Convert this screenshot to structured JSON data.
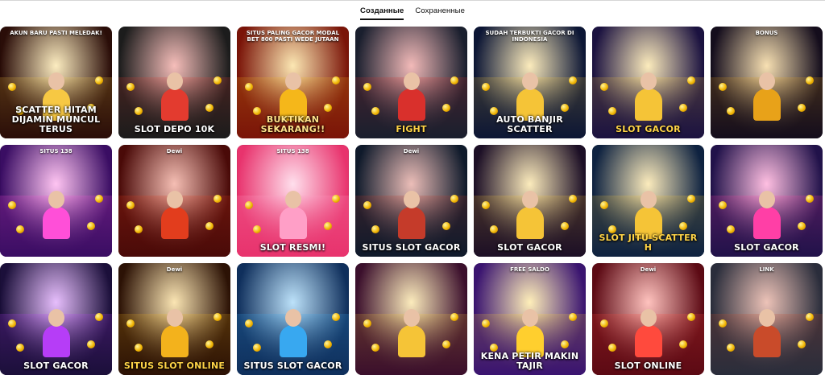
{
  "tabs": [
    {
      "label": "Созданные",
      "active": true
    },
    {
      "label": "Сохраненные",
      "active": false
    }
  ],
  "pins": [
    {
      "top": "AKUN BARU PASTI MELEDAK!",
      "caption": "SCATTER HITAM DIJAMIN MUNCUL TERUS",
      "bg": "#2a0d08",
      "accent": "#f7c843",
      "capColor": "#ffffff"
    },
    {
      "top": "",
      "caption": "SLOT DEPO 10K",
      "bg": "#1c1c1c",
      "accent": "#e33b2f",
      "capColor": "#ffffff"
    },
    {
      "top": "SITUS PALING GACOR MODAL BET 800 PASTI WEDE JUTAAN",
      "caption": "BUKTIKAN SEKARANG!!",
      "bg": "#7a1408",
      "accent": "#f5b71a",
      "capColor": "#ffe28a"
    },
    {
      "top": "",
      "caption": "FIGHT",
      "bg": "#1a1f2e",
      "accent": "#d9302c",
      "capColor": "#ffd447"
    },
    {
      "top": "SUDAH TERBUKTI GACOR DI INDONESIA",
      "caption": "AUTO BANJIR SCATTER",
      "bg": "#0c1635",
      "accent": "#f5c437",
      "capColor": "#ffffff"
    },
    {
      "top": "",
      "caption": "SLOT GACOR",
      "bg": "#1b1240",
      "accent": "#f5c437",
      "capColor": "#ffd447"
    },
    {
      "top": "BONUS",
      "caption": "",
      "bg": "#140d1c",
      "accent": "#e8a219",
      "capColor": "#ffffff"
    },
    {
      "top": "SITUS 138",
      "caption": "",
      "bg": "#3a0d63",
      "accent": "#ff4fd8",
      "capColor": "#ffffff"
    },
    {
      "top": "Dewi",
      "caption": "",
      "bg": "#4a0a08",
      "accent": "#e23d1d",
      "capColor": "#ffffff"
    },
    {
      "top": "SITUS 138",
      "caption": "SLOT RESMI!",
      "bg": "#e8336d",
      "accent": "#ff9fc7",
      "capColor": "#ffffff"
    },
    {
      "top": "Dewi",
      "caption": "SITUS SLOT GACOR",
      "bg": "#0f1a2b",
      "accent": "#c53b2a",
      "capColor": "#ffffff"
    },
    {
      "top": "",
      "caption": "SLOT GACOR",
      "bg": "#1c0f26",
      "accent": "#f5c437",
      "capColor": "#ffffff"
    },
    {
      "top": "",
      "caption": "SLOT JITU SCATTER H",
      "bg": "#0e2240",
      "accent": "#f5c437",
      "capColor": "#ffd447"
    },
    {
      "top": "",
      "caption": "SLOT GACOR",
      "bg": "#21124a",
      "accent": "#ff3fa6",
      "capColor": "#ffffff"
    },
    {
      "top": "",
      "caption": "SLOT GACOR",
      "bg": "#1b0f3a",
      "accent": "#b63df7",
      "capColor": "#ffffff"
    },
    {
      "top": "Dewi",
      "caption": "SITUS SLOT ONLINE",
      "bg": "#2c1205",
      "accent": "#f3b21c",
      "capColor": "#ffd447"
    },
    {
      "top": "",
      "caption": "SITUS SLOT GACOR",
      "bg": "#0f2f5c",
      "accent": "#38a8f0",
      "capColor": "#ffffff"
    },
    {
      "top": "",
      "caption": "",
      "bg": "#3b0f2c",
      "accent": "#f5c437",
      "capColor": "#ffffff"
    },
    {
      "top": "FREE SALDO",
      "caption": "KENA PETIR MAKIN TAJIR",
      "bg": "#3a1470",
      "accent": "#ffcf2e",
      "capColor": "#ffffff"
    },
    {
      "top": "Dewi",
      "caption": "SLOT ONLINE",
      "bg": "#5c0a14",
      "accent": "#ff4a3d",
      "capColor": "#ffffff"
    },
    {
      "top": "LINK",
      "caption": "",
      "bg": "#2a2d3b",
      "accent": "#c94b2a",
      "capColor": "#ffffff"
    }
  ]
}
